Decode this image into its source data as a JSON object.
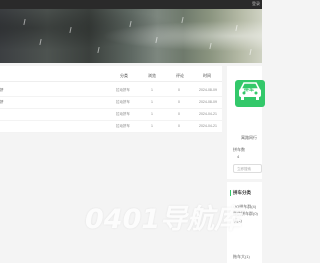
{
  "topbar": {
    "link": "登录"
  },
  "table": {
    "headers": [
      "分类",
      "浏览",
      "评论",
      "时间"
    ],
    "rows": [
      {
        "title": "拼",
        "category": "拉动拼车",
        "views": "1",
        "comments": "0",
        "time": "2024-08-09"
      },
      {
        "title": "拼",
        "category": "拉动拼车",
        "views": "1",
        "comments": "0",
        "time": "2024-08-09"
      },
      {
        "title": "",
        "category": "拉动拼车",
        "views": "1",
        "comments": "0",
        "time": "2024-04-21"
      },
      {
        "title": "",
        "category": "拉动拼车",
        "views": "1",
        "comments": "0",
        "time": "2024-04-21"
      }
    ]
  },
  "sidebar": {
    "badge_text": "拼车",
    "site_label": "寓路网行",
    "stat_label": "拼车数",
    "stat_value": "4",
    "input_placeholder": "立即搜索",
    "category_title": "拼车分类",
    "categories": [
      "QQ拼车群(4)",
      "微信拼车群(0)",
      "拼(1)"
    ],
    "footer_item": "拖车大(1)"
  },
  "watermark": "0401导航库",
  "colors": {
    "accent": "#33c86a",
    "topbar": "#2a2a2a"
  }
}
